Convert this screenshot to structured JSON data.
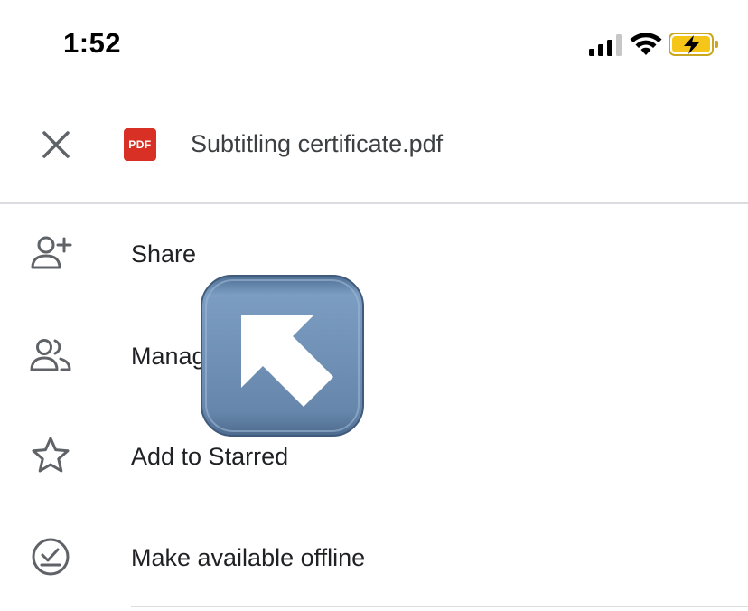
{
  "status_bar": {
    "time": "1:52"
  },
  "header": {
    "file_type_badge": "PDF",
    "file_name": "Subtitling certificate.pdf"
  },
  "menu": {
    "items": [
      {
        "icon": "add-person-icon",
        "label": "Share"
      },
      {
        "icon": "people-icon",
        "label": "Manag"
      },
      {
        "icon": "star-icon",
        "label": "Add to Starred"
      },
      {
        "icon": "offline-check-icon",
        "label": "Make available offline"
      }
    ]
  },
  "overlay": {
    "icon": "up-left-arrow-icon"
  },
  "colors": {
    "pdf_red": "#d93025",
    "icon_gray": "#5f6368",
    "divider": "#dadce0",
    "battery_yellow": "#f5c518",
    "arrow_blue": "#6f8fb5"
  }
}
